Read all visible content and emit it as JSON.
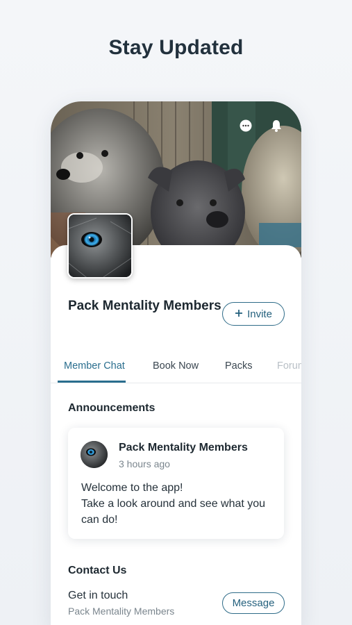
{
  "headline": "Stay Updated",
  "header": {
    "icons": [
      "chat-icon",
      "bell-icon"
    ]
  },
  "group": {
    "name": "Pack Mentality Members",
    "invite_label": "Invite",
    "invite_icon": "plus-icon"
  },
  "tabs": [
    {
      "label": "Member Chat",
      "active": true
    },
    {
      "label": "Book Now",
      "active": false
    },
    {
      "label": "Packs",
      "active": false
    },
    {
      "label": "Forum",
      "active": false
    }
  ],
  "announcements": {
    "title": "Announcements",
    "post": {
      "author": "Pack Mentality Members",
      "time": "3 hours ago",
      "body_line1": "Welcome to the app!",
      "body_line2": "Take a look around and see what you can do!"
    }
  },
  "contact": {
    "title": "Contact Us",
    "line1": "Get in touch",
    "line2": "Pack Mentality Members",
    "button_label": "Message"
  },
  "colors": {
    "accent": "#2a6e8e",
    "text": "#1d2830",
    "muted": "#7b868e",
    "eye_blue": "#3fb2f0"
  }
}
